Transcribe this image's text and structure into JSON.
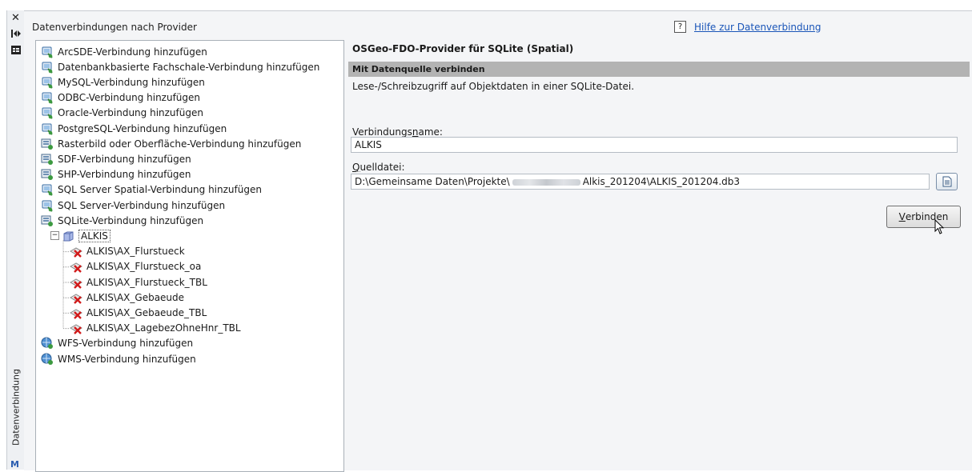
{
  "side_panel": {
    "vertical_title": "Datenverbindung",
    "close_icon": "✕",
    "bottom_icon_text": "M"
  },
  "left": {
    "title": "Datenverbindungen nach Provider",
    "tree": [
      {
        "label": "ArcSDE-Verbindung hinzufügen",
        "icon": "db-connect-icon",
        "level": 0
      },
      {
        "label": "Datenbankbasierte Fachschale-Verbindung hinzufügen",
        "icon": "db-connect-icon",
        "level": 0
      },
      {
        "label": "MySQL-Verbindung hinzufügen",
        "icon": "db-connect-icon",
        "level": 0
      },
      {
        "label": "ODBC-Verbindung hinzufügen",
        "icon": "db-connect-icon",
        "level": 0
      },
      {
        "label": "Oracle-Verbindung hinzufügen",
        "icon": "db-connect-icon",
        "level": 0
      },
      {
        "label": "PostgreSQL-Verbindung hinzufügen",
        "icon": "db-connect-icon",
        "level": 0
      },
      {
        "label": "Rasterbild oder Oberfläche-Verbindung hinzufügen",
        "icon": "file-connect-icon",
        "level": 0
      },
      {
        "label": "SDF-Verbindung hinzufügen",
        "icon": "file-connect-icon",
        "level": 0
      },
      {
        "label": "SHP-Verbindung hinzufügen",
        "icon": "file-connect-icon",
        "level": 0
      },
      {
        "label": "SQL Server Spatial-Verbindung hinzufügen",
        "icon": "db-connect-icon",
        "level": 0
      },
      {
        "label": "SQL Server-Verbindung hinzufügen",
        "icon": "db-connect-icon",
        "level": 0
      },
      {
        "label": "SQLite-Verbindung hinzufügen",
        "icon": "file-connect-icon",
        "level": 0
      },
      {
        "label": "ALKIS",
        "icon": "datastore-icon",
        "level": 1,
        "expanded": true
      },
      {
        "label": "ALKIS\\AX_Flurstueck",
        "icon": "layer-disconnected-icon",
        "level": 2
      },
      {
        "label": "ALKIS\\AX_Flurstueck_oa",
        "icon": "layer-disconnected-icon",
        "level": 2
      },
      {
        "label": "ALKIS\\AX_Flurstueck_TBL",
        "icon": "layer-disconnected-icon",
        "level": 2
      },
      {
        "label": "ALKIS\\AX_Gebaeude",
        "icon": "layer-disconnected-icon",
        "level": 2
      },
      {
        "label": "ALKIS\\AX_Gebaeude_TBL",
        "icon": "layer-disconnected-icon",
        "level": 2
      },
      {
        "label": "ALKIS\\AX_LagebezOhneHnr_TBL",
        "icon": "layer-disconnected-icon",
        "level": 2
      },
      {
        "label": "WFS-Verbindung hinzufügen",
        "icon": "web-connect-icon",
        "level": 0
      },
      {
        "label": "WMS-Verbindung hinzufügen",
        "icon": "web-connect-icon",
        "level": 0
      }
    ]
  },
  "right": {
    "help_icon": "?",
    "help_link": "Hilfe zur Datenverbindung",
    "provider_title": "OSGeo-FDO-Provider für SQLite (Spatial)",
    "section_title": "Mit Datenquelle verbinden",
    "description": "Lese-/Schreibzugriff auf Objektdaten in einer SQLite-Datei.",
    "connection_name_label": "Verbindungsname:",
    "connection_name_value": "ALKIS",
    "source_file_label": "Quelldatei:",
    "source_file_prefix": "D:\\Gemeinsame Daten\\Projekte\\",
    "source_file_suffix": "Alkis_201204\\ALKIS_201204.db3",
    "connect_button": "Verbinden"
  },
  "colors": {
    "link": "#1a55b8",
    "section_bar": "#b3b3b3",
    "panel_bg": "#f4f5f7"
  }
}
